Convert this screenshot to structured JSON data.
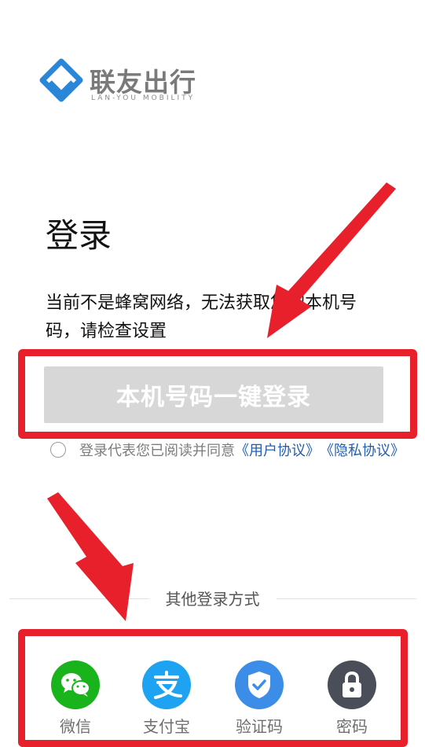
{
  "brand": {
    "name": "联友出行",
    "subtitle": "LAN-YOU MOBILITY",
    "logo_color": "#2a86d6"
  },
  "login": {
    "title": "登录",
    "notice": "当前不是蜂窝网络，无法获取您的本机号码，请检查设置",
    "onekey_button": "本机号码一键登录"
  },
  "agreement": {
    "prefix": "登录代表您已阅读并同意",
    "user_agreement": "《用户协议》",
    "privacy_agreement": "《隐私协议》"
  },
  "other_login": {
    "title": "其他登录方式",
    "methods": [
      {
        "label": "微信",
        "icon": "wechat-icon",
        "color": "#19b31b"
      },
      {
        "label": "支付宝",
        "icon": "alipay-icon",
        "color": "#1ea2f2"
      },
      {
        "label": "验证码",
        "icon": "shield-check-icon",
        "color": "#3c8de8"
      },
      {
        "label": "密码",
        "icon": "lock-icon",
        "color": "#4a4e59"
      }
    ]
  },
  "annotations": {
    "highlight_color": "#e8202b"
  }
}
